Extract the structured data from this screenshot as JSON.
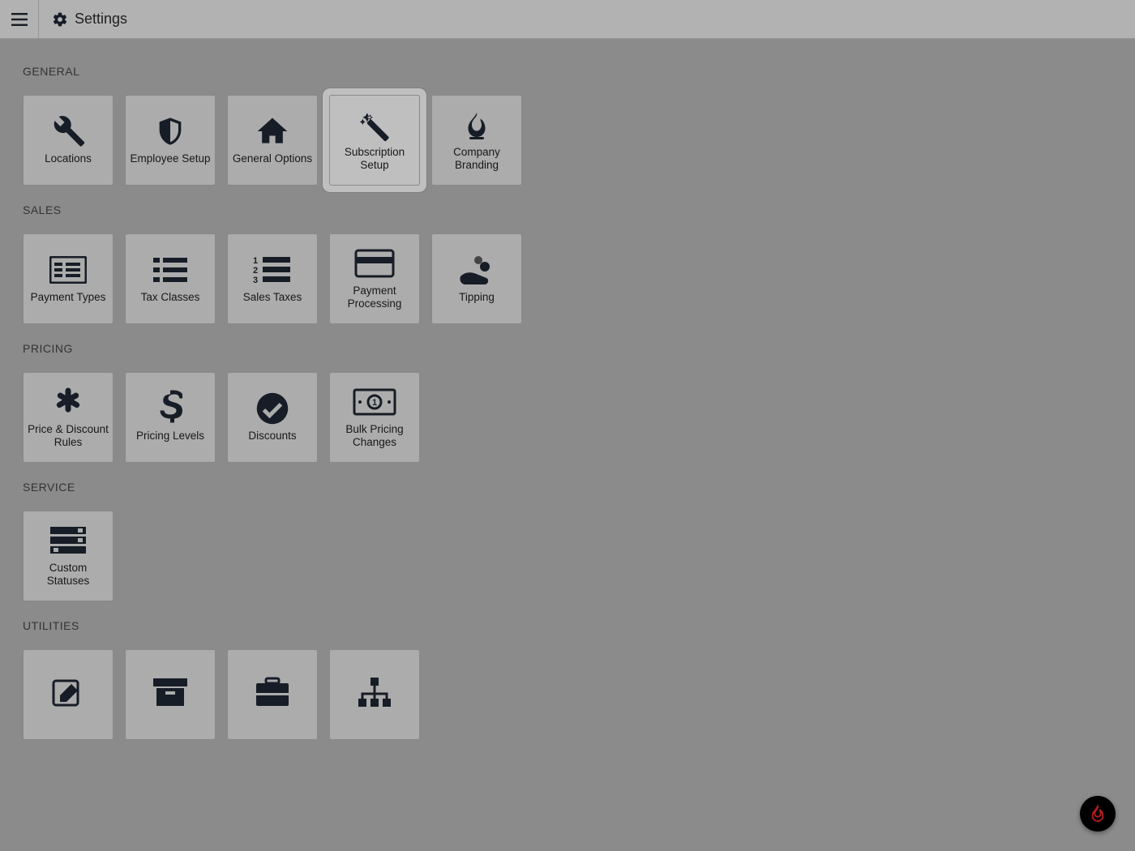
{
  "header": {
    "title": "Settings"
  },
  "sections": {
    "general": {
      "heading": "GENERAL",
      "items": {
        "locations": "Locations",
        "employee_setup": "Employee Setup",
        "general_options": "General Options",
        "subscription_setup": "Subscription Setup",
        "company_branding": "Company Branding"
      }
    },
    "sales": {
      "heading": "SALES",
      "items": {
        "payment_types": "Payment Types",
        "tax_classes": "Tax Classes",
        "sales_taxes": "Sales Taxes",
        "payment_processing": "Payment Processing",
        "tipping": "Tipping"
      }
    },
    "pricing": {
      "heading": "PRICING",
      "items": {
        "price_discount_rules": "Price & Discount Rules",
        "pricing_levels": "Pricing Levels",
        "discounts": "Discounts",
        "bulk_pricing": "Bulk Pricing Changes"
      }
    },
    "service": {
      "heading": "SERVICE",
      "items": {
        "custom_statuses": "Custom Statuses"
      }
    },
    "utilities": {
      "heading": "UTILITIES"
    }
  },
  "highlighted_tile": "subscription_setup",
  "fab_icon": "flame-icon"
}
